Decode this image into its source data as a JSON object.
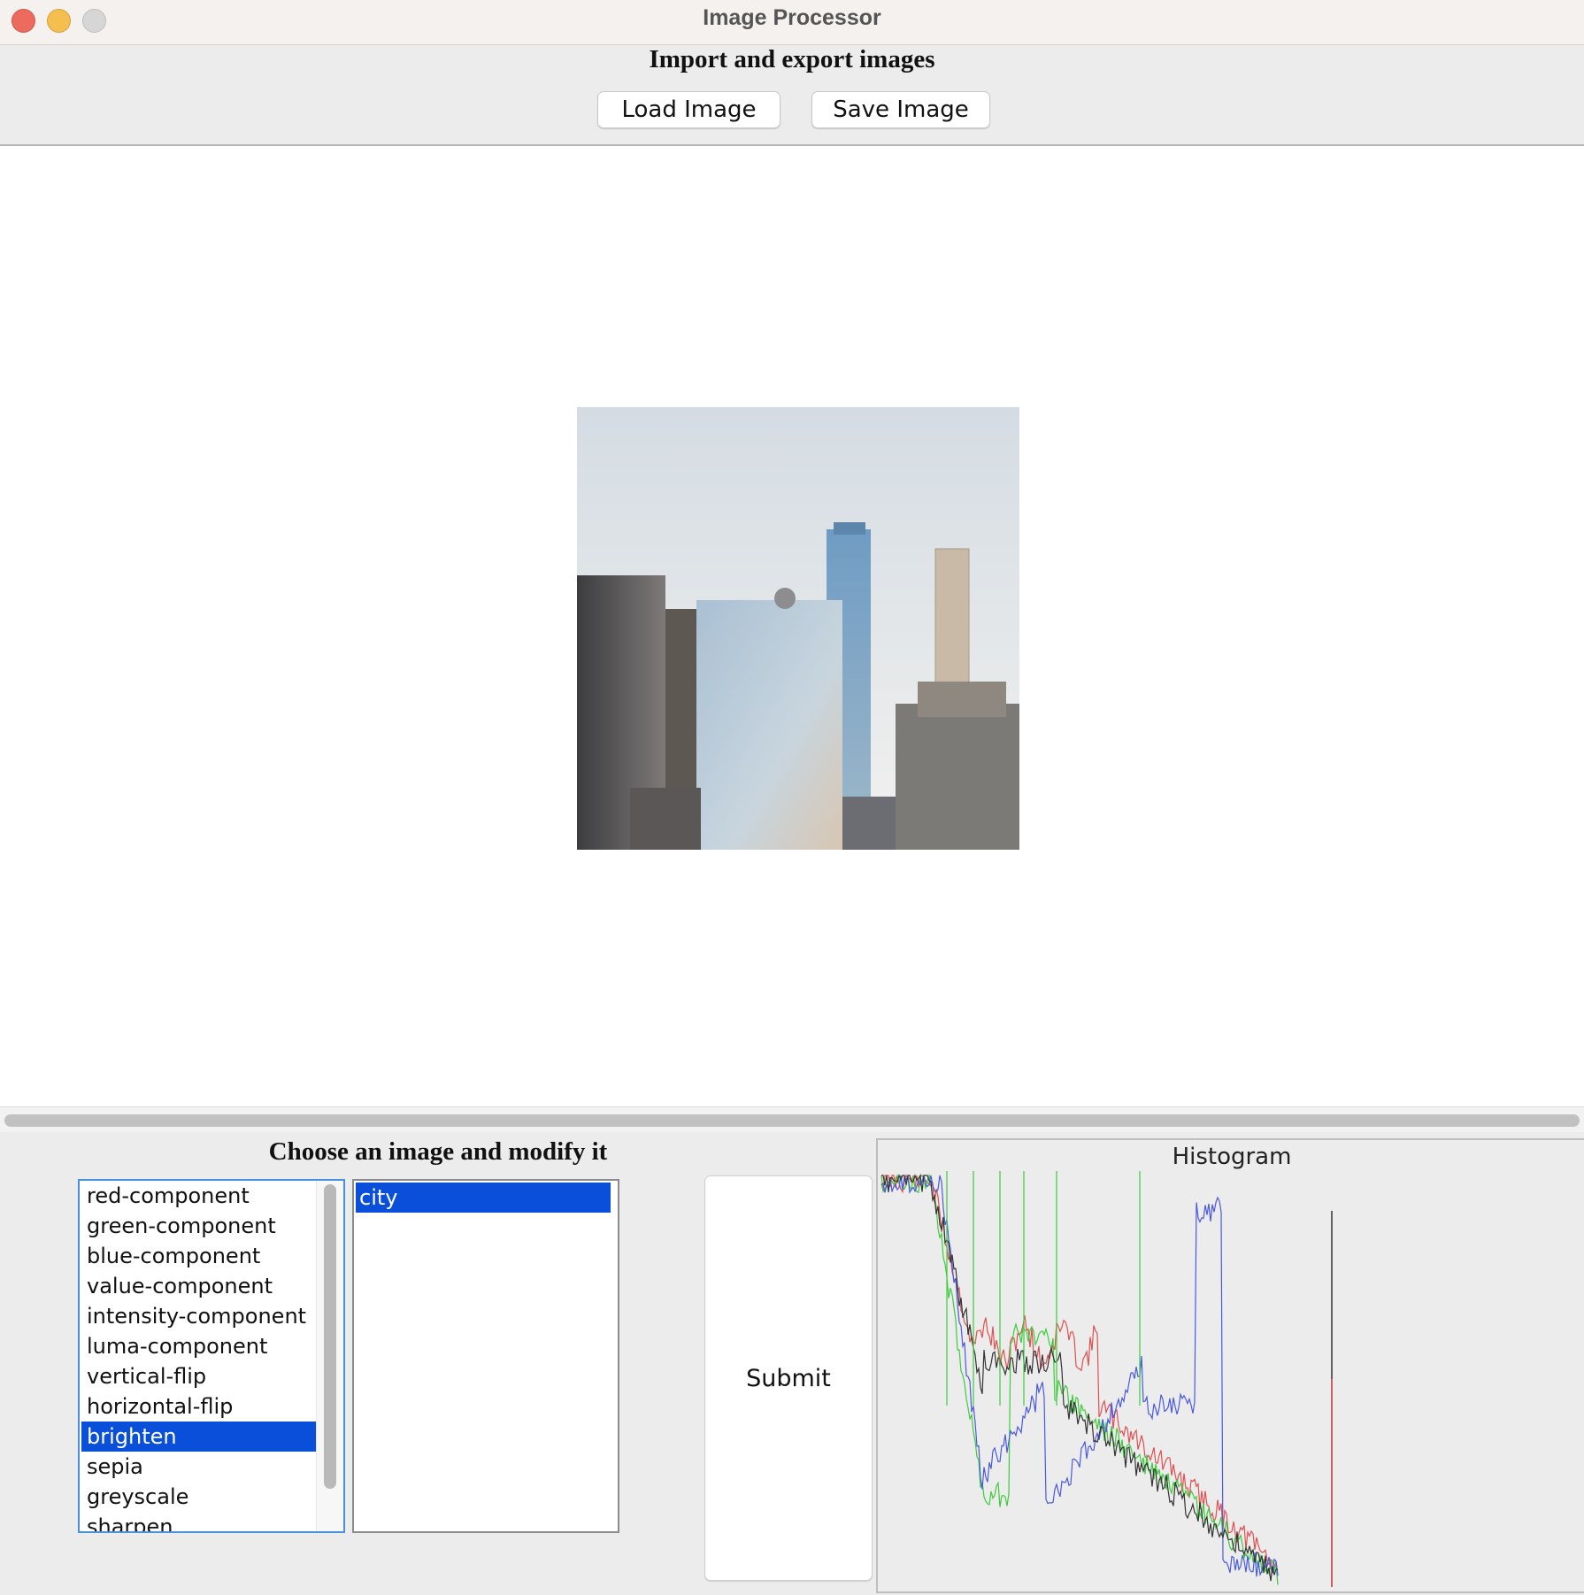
{
  "window": {
    "title": "Image Processor"
  },
  "top_panel": {
    "heading": "Import and export images",
    "load_button": "Load Image",
    "save_button": "Save Image"
  },
  "bottom_panel": {
    "heading": "Choose an image and modify it",
    "operations": [
      "red-component",
      "green-component",
      "blue-component",
      "value-component",
      "intensity-component",
      "luma-component",
      "vertical-flip",
      "horizontal-flip",
      "brighten",
      "sepia",
      "greyscale",
      "sharpen"
    ],
    "selected_operation": "brighten",
    "images": [
      "city"
    ],
    "selected_image": "city",
    "submit_button": "Submit",
    "histogram_title": "Histogram"
  },
  "colors": {
    "selection": "#0a4fd9",
    "hist_red": "#e05050",
    "hist_green": "#3ccc3c",
    "hist_blue": "#4a5ae0",
    "hist_intensity": "#333333"
  }
}
